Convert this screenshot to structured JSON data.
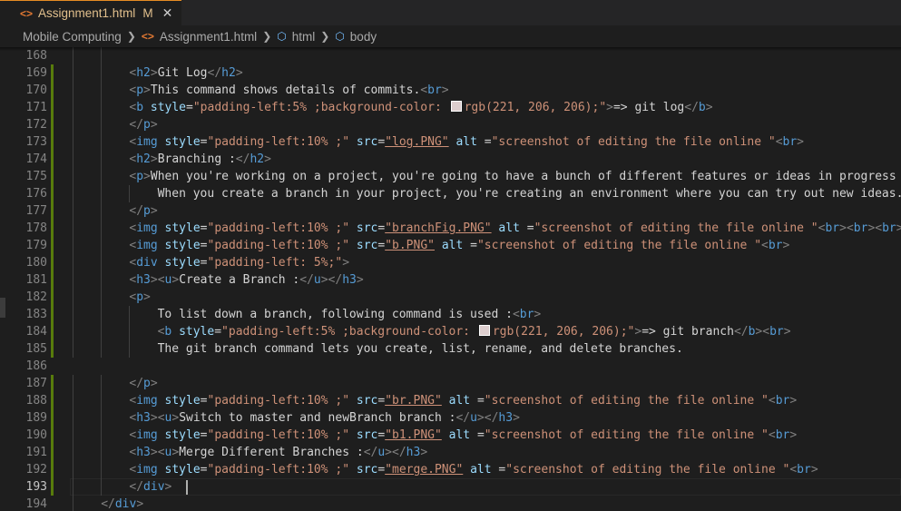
{
  "tab": {
    "title": "Assignment1.html",
    "status": "M",
    "icon": "<>"
  },
  "breadcrumbs": [
    "Mobile Computing",
    "Assignment1.html",
    "html",
    "body"
  ],
  "colors": {
    "tag": "#569cd6",
    "attr": "#9cdcfe",
    "string": "#ce9178",
    "modified": "#e2c08d",
    "added_gutter": "#587c0c"
  },
  "lines": [
    {
      "n": "168",
      "indent": 10,
      "mod": false,
      "parts": []
    },
    {
      "n": "169",
      "indent": 8,
      "mod": true,
      "parts": [
        [
          "t",
          "<"
        ],
        [
          "n",
          "h2"
        ],
        [
          "t",
          ">"
        ],
        [
          "x",
          "Git Log"
        ],
        [
          "t",
          "</"
        ],
        [
          "n",
          "h2"
        ],
        [
          "t",
          ">"
        ]
      ]
    },
    {
      "n": "170",
      "indent": 8,
      "mod": true,
      "parts": [
        [
          "t",
          "<"
        ],
        [
          "n",
          "p"
        ],
        [
          "t",
          ">"
        ],
        [
          "x",
          "This command shows details of commits."
        ],
        [
          "t",
          "<"
        ],
        [
          "n",
          "br"
        ],
        [
          "t",
          ">"
        ]
      ]
    },
    {
      "n": "171",
      "indent": 8,
      "mod": true,
      "parts": [
        [
          "t",
          "<"
        ],
        [
          "n",
          "b"
        ],
        [
          "x",
          " "
        ],
        [
          "a",
          "style"
        ],
        [
          "x",
          "="
        ],
        [
          "s",
          "\"padding-left:5% ;background-color: "
        ],
        [
          "sw",
          ""
        ],
        [
          "s",
          "rgb(221, 206, 206);\""
        ],
        [
          "t",
          ">"
        ],
        [
          "x",
          "=> git log"
        ],
        [
          "t",
          "</"
        ],
        [
          "n",
          "b"
        ],
        [
          "t",
          ">"
        ]
      ]
    },
    {
      "n": "172",
      "indent": 8,
      "mod": true,
      "parts": [
        [
          "t",
          "</"
        ],
        [
          "n",
          "p"
        ],
        [
          "t",
          ">"
        ]
      ]
    },
    {
      "n": "173",
      "indent": 8,
      "mod": true,
      "parts": [
        [
          "t",
          "<"
        ],
        [
          "n",
          "img"
        ],
        [
          "x",
          " "
        ],
        [
          "a",
          "style"
        ],
        [
          "x",
          "="
        ],
        [
          "s",
          "\"padding-left:10% ;\""
        ],
        [
          "x",
          " "
        ],
        [
          "a",
          "src"
        ],
        [
          "x",
          "="
        ],
        [
          "su",
          "\"log.PNG\""
        ],
        [
          "x",
          " "
        ],
        [
          "a",
          "alt"
        ],
        [
          "x",
          " ="
        ],
        [
          "s",
          "\"screenshot of editing the file online \""
        ],
        [
          "t",
          "<"
        ],
        [
          "n",
          "br"
        ],
        [
          "t",
          ">"
        ]
      ]
    },
    {
      "n": "174",
      "indent": 8,
      "mod": true,
      "parts": [
        [
          "t",
          "<"
        ],
        [
          "n",
          "h2"
        ],
        [
          "t",
          ">"
        ],
        [
          "x",
          "Branching :"
        ],
        [
          "t",
          "</"
        ],
        [
          "n",
          "h2"
        ],
        [
          "t",
          ">"
        ]
      ]
    },
    {
      "n": "175",
      "indent": 8,
      "mod": true,
      "parts": [
        [
          "t",
          "<"
        ],
        [
          "n",
          "p"
        ],
        [
          "t",
          ">"
        ],
        [
          "x",
          "When you're working on a project, you're going to have a bunch of different features or ideas in progress at"
        ]
      ]
    },
    {
      "n": "176",
      "indent": 12,
      "mod": true,
      "parts": [
        [
          "x",
          "When you create a branch in your project, you're creating an environment where you can try out new ideas. C"
        ]
      ]
    },
    {
      "n": "177",
      "indent": 8,
      "mod": true,
      "parts": [
        [
          "t",
          "</"
        ],
        [
          "n",
          "p"
        ],
        [
          "t",
          ">"
        ]
      ]
    },
    {
      "n": "178",
      "indent": 8,
      "mod": true,
      "parts": [
        [
          "t",
          "<"
        ],
        [
          "n",
          "img"
        ],
        [
          "x",
          " "
        ],
        [
          "a",
          "style"
        ],
        [
          "x",
          "="
        ],
        [
          "s",
          "\"padding-left:10% ;\""
        ],
        [
          "x",
          " "
        ],
        [
          "a",
          "src"
        ],
        [
          "x",
          "="
        ],
        [
          "su",
          "\"branchFig.PNG\""
        ],
        [
          "x",
          " "
        ],
        [
          "a",
          "alt"
        ],
        [
          "x",
          " ="
        ],
        [
          "s",
          "\"screenshot of editing the file online \""
        ],
        [
          "t",
          "<"
        ],
        [
          "n",
          "br"
        ],
        [
          "t",
          "><"
        ],
        [
          "n",
          "br"
        ],
        [
          "t",
          "><"
        ],
        [
          "n",
          "br"
        ],
        [
          "t",
          ">"
        ]
      ]
    },
    {
      "n": "179",
      "indent": 8,
      "mod": true,
      "parts": [
        [
          "t",
          "<"
        ],
        [
          "n",
          "img"
        ],
        [
          "x",
          " "
        ],
        [
          "a",
          "style"
        ],
        [
          "x",
          "="
        ],
        [
          "s",
          "\"padding-left:10% ;\""
        ],
        [
          "x",
          " "
        ],
        [
          "a",
          "src"
        ],
        [
          "x",
          "="
        ],
        [
          "su",
          "\"b.PNG\""
        ],
        [
          "x",
          " "
        ],
        [
          "a",
          "alt"
        ],
        [
          "x",
          " ="
        ],
        [
          "s",
          "\"screenshot of editing the file online \""
        ],
        [
          "t",
          "<"
        ],
        [
          "n",
          "br"
        ],
        [
          "t",
          ">"
        ]
      ]
    },
    {
      "n": "180",
      "indent": 8,
      "mod": true,
      "parts": [
        [
          "t",
          "<"
        ],
        [
          "n",
          "div"
        ],
        [
          "x",
          " "
        ],
        [
          "a",
          "style"
        ],
        [
          "x",
          "="
        ],
        [
          "s",
          "\"padding-left: 5%;\""
        ],
        [
          "t",
          ">"
        ]
      ]
    },
    {
      "n": "181",
      "indent": 8,
      "mod": true,
      "parts": [
        [
          "t",
          "<"
        ],
        [
          "n",
          "h3"
        ],
        [
          "t",
          "><"
        ],
        [
          "n",
          "u"
        ],
        [
          "t",
          ">"
        ],
        [
          "x",
          "Create a Branch :"
        ],
        [
          "t",
          "</"
        ],
        [
          "n",
          "u"
        ],
        [
          "t",
          "></"
        ],
        [
          "n",
          "h3"
        ],
        [
          "t",
          ">"
        ]
      ]
    },
    {
      "n": "182",
      "indent": 8,
      "mod": true,
      "parts": [
        [
          "t",
          "<"
        ],
        [
          "n",
          "p"
        ],
        [
          "t",
          ">"
        ]
      ]
    },
    {
      "n": "183",
      "indent": 12,
      "mod": true,
      "parts": [
        [
          "x",
          "To list down a branch, following command is used :"
        ],
        [
          "t",
          "<"
        ],
        [
          "n",
          "br"
        ],
        [
          "t",
          ">"
        ]
      ]
    },
    {
      "n": "184",
      "indent": 12,
      "mod": true,
      "parts": [
        [
          "t",
          "<"
        ],
        [
          "n",
          "b"
        ],
        [
          "x",
          " "
        ],
        [
          "a",
          "style"
        ],
        [
          "x",
          "="
        ],
        [
          "s",
          "\"padding-left:5% ;background-color: "
        ],
        [
          "sw",
          ""
        ],
        [
          "s",
          "rgb(221, 206, 206);\""
        ],
        [
          "t",
          ">"
        ],
        [
          "x",
          "=> git branch"
        ],
        [
          "t",
          "</"
        ],
        [
          "n",
          "b"
        ],
        [
          "t",
          "><"
        ],
        [
          "n",
          "br"
        ],
        [
          "t",
          ">"
        ]
      ]
    },
    {
      "n": "185",
      "indent": 12,
      "mod": true,
      "parts": [
        [
          "x",
          "The git branch command lets you create, list, rename, and delete branches."
        ]
      ]
    },
    {
      "n": "186",
      "indent": 0,
      "mod": false,
      "parts": []
    },
    {
      "n": "187",
      "indent": 8,
      "mod": true,
      "parts": [
        [
          "t",
          "</"
        ],
        [
          "n",
          "p"
        ],
        [
          "t",
          ">"
        ]
      ]
    },
    {
      "n": "188",
      "indent": 8,
      "mod": true,
      "parts": [
        [
          "t",
          "<"
        ],
        [
          "n",
          "img"
        ],
        [
          "x",
          " "
        ],
        [
          "a",
          "style"
        ],
        [
          "x",
          "="
        ],
        [
          "s",
          "\"padding-left:10% ;\""
        ],
        [
          "x",
          " "
        ],
        [
          "a",
          "src"
        ],
        [
          "x",
          "="
        ],
        [
          "su",
          "\"br.PNG\""
        ],
        [
          "x",
          " "
        ],
        [
          "a",
          "alt"
        ],
        [
          "x",
          " ="
        ],
        [
          "s",
          "\"screenshot of editing the file online \""
        ],
        [
          "t",
          "<"
        ],
        [
          "n",
          "br"
        ],
        [
          "t",
          ">"
        ]
      ]
    },
    {
      "n": "189",
      "indent": 8,
      "mod": true,
      "parts": [
        [
          "t",
          "<"
        ],
        [
          "n",
          "h3"
        ],
        [
          "t",
          "><"
        ],
        [
          "n",
          "u"
        ],
        [
          "t",
          ">"
        ],
        [
          "x",
          "Switch to master and newBranch branch :"
        ],
        [
          "t",
          "</"
        ],
        [
          "n",
          "u"
        ],
        [
          "t",
          "></"
        ],
        [
          "n",
          "h3"
        ],
        [
          "t",
          ">"
        ]
      ]
    },
    {
      "n": "190",
      "indent": 8,
      "mod": true,
      "parts": [
        [
          "t",
          "<"
        ],
        [
          "n",
          "img"
        ],
        [
          "x",
          " "
        ],
        [
          "a",
          "style"
        ],
        [
          "x",
          "="
        ],
        [
          "s",
          "\"padding-left:10% ;\""
        ],
        [
          "x",
          " "
        ],
        [
          "a",
          "src"
        ],
        [
          "x",
          "="
        ],
        [
          "su",
          "\"b1.PNG\""
        ],
        [
          "x",
          " "
        ],
        [
          "a",
          "alt"
        ],
        [
          "x",
          " ="
        ],
        [
          "s",
          "\"screenshot of editing the file online \""
        ],
        [
          "t",
          "<"
        ],
        [
          "n",
          "br"
        ],
        [
          "t",
          ">"
        ]
      ]
    },
    {
      "n": "191",
      "indent": 8,
      "mod": true,
      "parts": [
        [
          "t",
          "<"
        ],
        [
          "n",
          "h3"
        ],
        [
          "t",
          "><"
        ],
        [
          "n",
          "u"
        ],
        [
          "t",
          ">"
        ],
        [
          "x",
          "Merge Different Branches :"
        ],
        [
          "t",
          "</"
        ],
        [
          "n",
          "u"
        ],
        [
          "t",
          "></"
        ],
        [
          "n",
          "h3"
        ],
        [
          "t",
          ">"
        ]
      ]
    },
    {
      "n": "192",
      "indent": 8,
      "mod": true,
      "parts": [
        [
          "t",
          "<"
        ],
        [
          "n",
          "img"
        ],
        [
          "x",
          " "
        ],
        [
          "a",
          "style"
        ],
        [
          "x",
          "="
        ],
        [
          "s",
          "\"padding-left:10% ;\""
        ],
        [
          "x",
          " "
        ],
        [
          "a",
          "src"
        ],
        [
          "x",
          "="
        ],
        [
          "su",
          "\"merge.PNG\""
        ],
        [
          "x",
          " "
        ],
        [
          "a",
          "alt"
        ],
        [
          "x",
          " ="
        ],
        [
          "s",
          "\"screenshot of editing the file online \""
        ],
        [
          "t",
          "<"
        ],
        [
          "n",
          "br"
        ],
        [
          "t",
          ">"
        ]
      ]
    },
    {
      "n": "193",
      "indent": 8,
      "mod": true,
      "current": true,
      "parts": [
        [
          "t",
          "</"
        ],
        [
          "n",
          "div"
        ],
        [
          "t",
          ">"
        ],
        [
          "x",
          "  "
        ]
      ]
    },
    {
      "n": "194",
      "indent": 4,
      "mod": false,
      "parts": [
        [
          "t",
          "</"
        ],
        [
          "n",
          "div"
        ],
        [
          "t",
          ">"
        ]
      ]
    }
  ]
}
